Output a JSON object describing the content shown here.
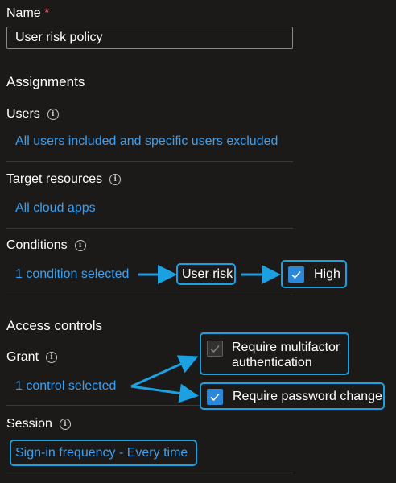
{
  "name_field": {
    "label": "Name",
    "required_mark": "*",
    "value": "User risk policy"
  },
  "assignments": {
    "heading": "Assignments",
    "users": {
      "label": "Users",
      "link": "All users included and specific users excluded"
    },
    "target_resources": {
      "label": "Target resources",
      "link": "All cloud apps"
    },
    "conditions": {
      "label": "Conditions",
      "link": "1 condition selected",
      "callout_condition": "User risk",
      "callout_level": "High"
    }
  },
  "access_controls": {
    "heading": "Access controls",
    "grant": {
      "label": "Grant",
      "link": "1 control selected",
      "option_mfa_line1": "Require multifactor",
      "option_mfa_line2": "authentication",
      "option_mfa_checked": false,
      "option_pw_change": "Require password change",
      "option_pw_checked": true
    },
    "session": {
      "label": "Session",
      "link": "Sign-in frequency - Every time"
    }
  },
  "icons": {
    "info": "info-icon",
    "checkmark": "checkmark-icon",
    "arrow": "arrow-right-icon"
  },
  "colors": {
    "background": "#1b1a19",
    "link": "#3aa0f3",
    "callout_border": "#1ba1e2",
    "checkbox_checked": "#2b88d8",
    "required": "#f1707b"
  }
}
